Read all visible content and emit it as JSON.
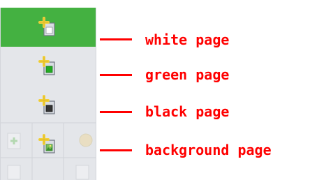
{
  "toolbar": {
    "buttons": [
      {
        "icon": "add-white-page-icon",
        "active": true,
        "fill": "#ffffff"
      },
      {
        "icon": "add-green-page-icon",
        "active": false,
        "fill": "#22aa22"
      },
      {
        "icon": "add-black-page-icon",
        "active": false,
        "fill": "#333333"
      },
      {
        "icon": "add-background-page-icon",
        "active": false,
        "fill": "#3a8f2e"
      }
    ]
  },
  "callouts": [
    {
      "label": "white page"
    },
    {
      "label": "green page"
    },
    {
      "label": "black page"
    },
    {
      "label": "background page"
    }
  ],
  "colors": {
    "accent": "#ff0000",
    "active_bg": "#44b141",
    "toolbar_bg": "#e4e6ea",
    "plus": "#f2d13b"
  }
}
